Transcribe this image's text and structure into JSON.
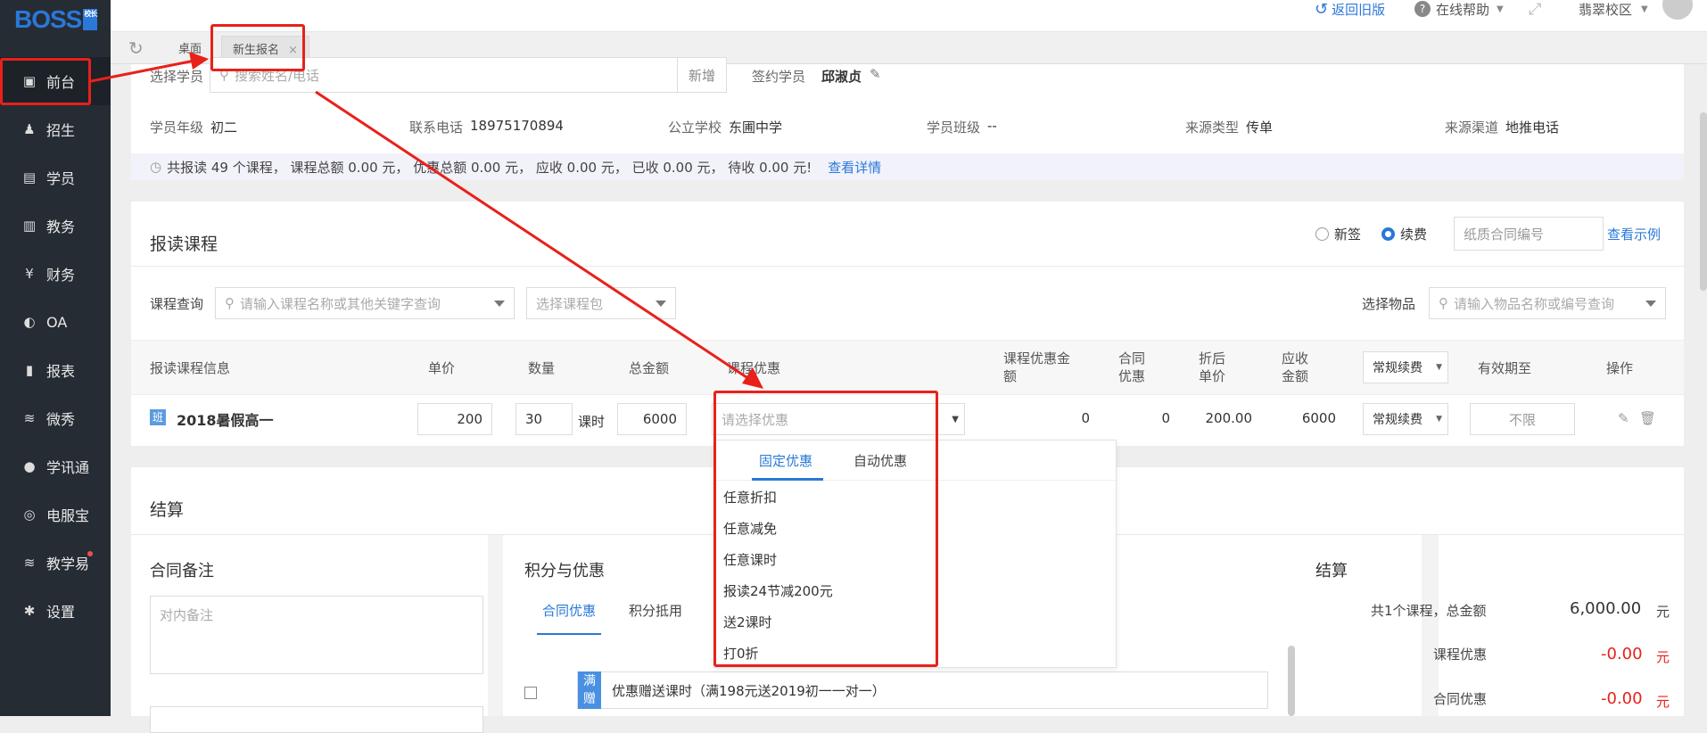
{
  "brand": {
    "logo": "BOSS",
    "logo_sub": "校长"
  },
  "sidebar": {
    "items": [
      {
        "label": "前台",
        "icon": "calendar-icon"
      },
      {
        "label": "招生",
        "icon": "user-add-icon"
      },
      {
        "label": "学员",
        "icon": "contact-card-icon"
      },
      {
        "label": "教务",
        "icon": "book-icon"
      },
      {
        "label": "财务",
        "icon": "yen-icon"
      },
      {
        "label": "OA",
        "icon": "chat-icon"
      },
      {
        "label": "报表",
        "icon": "bar-chart-icon"
      },
      {
        "label": "微秀",
        "icon": "bookmark-icon"
      },
      {
        "label": "学讯通",
        "icon": "location-icon"
      },
      {
        "label": "电服宝",
        "icon": "phone-icon"
      },
      {
        "label": "教学易",
        "icon": "clipboard-icon"
      },
      {
        "label": "设置",
        "icon": "gear-icon"
      }
    ]
  },
  "topbar": {
    "back_old": "返回旧版",
    "help": "在线帮助",
    "campus": "翡翠校区"
  },
  "tabs": {
    "desk": "桌面",
    "new_enroll": "新生报名",
    "close": "×"
  },
  "student": {
    "select_label": "选择学员",
    "search_placeholder": "搜索姓名/电话",
    "add": "新增",
    "signed_label": "签约学员",
    "signed_name": "邱淑贞",
    "grade_label": "学员年级",
    "grade": "初二",
    "phone_label": "联系电话",
    "phone": "18975170894",
    "school_label": "公立学校",
    "school": "东圃中学",
    "class_label": "学员班级",
    "class": "--",
    "source_type_label": "来源类型",
    "source_type": "传单",
    "channel_label": "来源渠道",
    "channel": "地推电话",
    "summary": "共报读 49 个课程， 课程总额 0.00 元， 优惠总额 0.00 元， 应收 0.00 元， 已收 0.00 元， 待收 0.00 元!",
    "detail_link": "查看详情"
  },
  "enroll": {
    "title": "报读课程",
    "radio_new": "新签",
    "radio_renew": "续费",
    "contract_placeholder": "纸质合同编号",
    "example_link": "查看示例",
    "course_query_label": "课程查询",
    "course_query_placeholder": "请输入课程名称或其他关键字查询",
    "package_placeholder": "选择课程包",
    "goods_label": "选择物品",
    "goods_placeholder": "请输入物品名称或编号查询",
    "headers": {
      "info": "报读课程信息",
      "price": "单价",
      "qty": "数量",
      "total": "总金额",
      "discount": "课程优惠",
      "discount_amt": "课程优惠金额",
      "contract_disc": "合同优惠",
      "unit_after": "折后单价",
      "receivable": "应收金额",
      "renew_type": "常规续费",
      "valid": "有效期至",
      "op": "操作"
    },
    "row": {
      "badge": "班",
      "name": "2018暑假高一",
      "price": "200",
      "qty": "30",
      "unit": "课时",
      "total": "6000",
      "discount_placeholder": "请选择优惠",
      "discount_amt": "0",
      "contract_disc": "0",
      "unit_after": "200.00",
      "receivable": "6000",
      "renew_type": "常规续费",
      "valid": "不限"
    }
  },
  "dropdown": {
    "tab_fixed": "固定优惠",
    "tab_auto": "自动优惠",
    "options": [
      "任意折扣",
      "任意减免",
      "任意课时",
      "报读24节减200元",
      "送2课时",
      "打0折"
    ]
  },
  "settle": {
    "title": "结算",
    "remark_title": "合同备注",
    "remark_placeholder": "对内备注",
    "points_title": "积分与优惠",
    "tab_contract": "合同优惠",
    "tab_points": "积分抵用",
    "promo_badge": "满赠",
    "promo_text": "优惠赠送课时（满198元送2019初一一对一）",
    "summary_title": "结算",
    "line1_label": "共1个课程，总金额",
    "line1_value": "6,000.00",
    "line1_unit": "元",
    "line2_label": "课程优惠",
    "line2_value": "-0.00",
    "line2_unit": "元",
    "line3_label": "合同优惠",
    "line3_value": "-0.00",
    "line3_unit": "元"
  },
  "colors": {
    "accent": "#2a78d8",
    "sidebar": "#262c34",
    "annotation": "#e8211a"
  }
}
